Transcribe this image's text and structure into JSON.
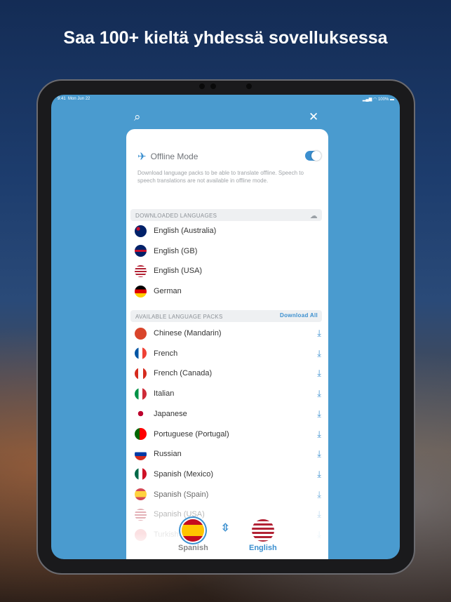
{
  "headline": "Saa 100+ kieltä yhdessä sovelluksessa",
  "status": {
    "time": "9:41",
    "date": "Mon Jun 22",
    "battery": "100%"
  },
  "offline": {
    "title": "Offline Mode",
    "enabled": true,
    "description": "Download language packs to be able to translate offline. Speech to speech translations are not available in offline mode."
  },
  "downloaded": {
    "header": "DOWNLOADED LANGUAGES",
    "items": [
      "English (Australia)",
      "English (GB)",
      "English (USA)",
      "German"
    ]
  },
  "available": {
    "header": "AVAILABLE LANGUAGE PACKS",
    "download_all": "Download All",
    "items": [
      "Chinese (Mandarin)",
      "French",
      "French (Canada)",
      "Italian",
      "Japanese",
      "Portuguese (Portugal)",
      "Russian",
      "Spanish (Mexico)",
      "Spanish (Spain)",
      "Spanish (USA)",
      "Turkish"
    ]
  },
  "bottom": {
    "source": "Spanish",
    "target": "English"
  },
  "colors": {
    "accent": "#3b8fcf",
    "screen": "#4a9bcf"
  }
}
